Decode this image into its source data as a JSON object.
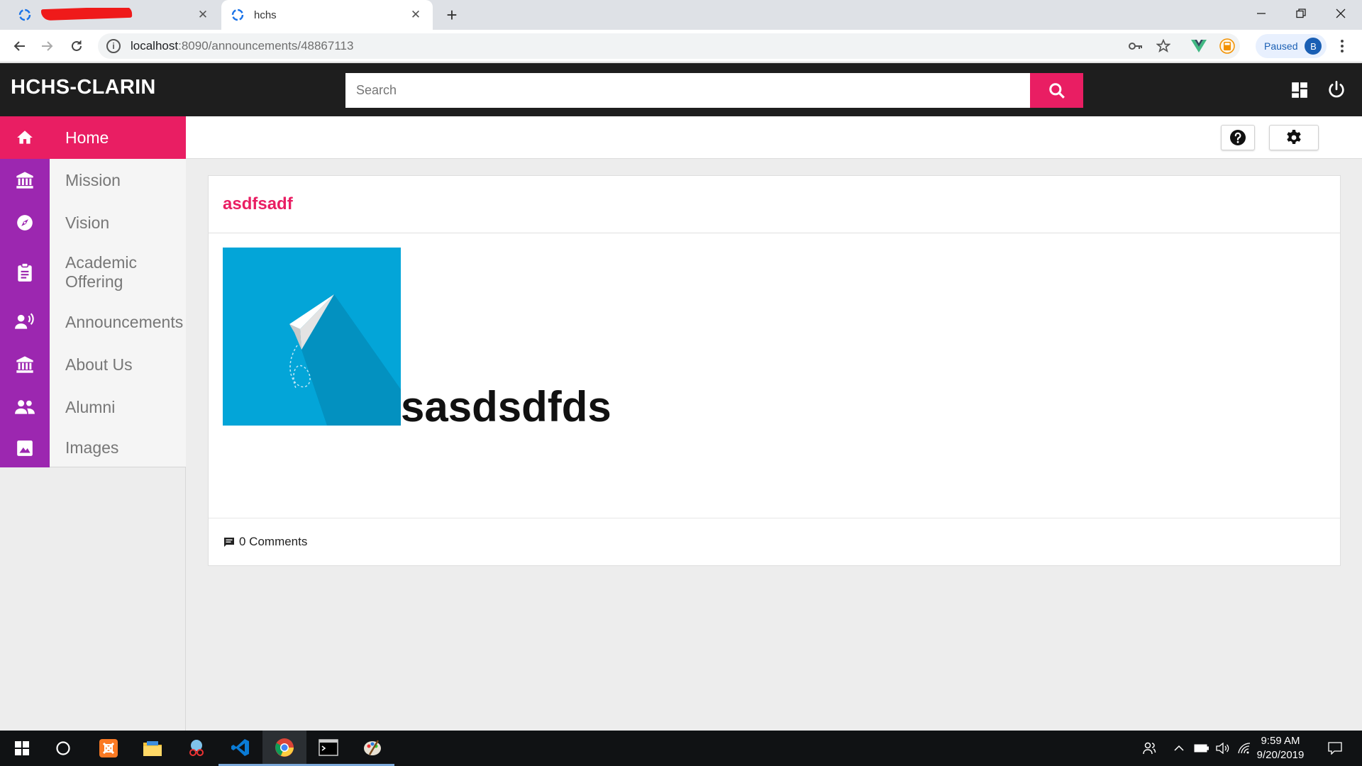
{
  "browser": {
    "tabs": [
      {
        "title": "",
        "redacted": true
      },
      {
        "title": "hchs",
        "active": true
      }
    ],
    "address": {
      "host": "localhost",
      "path": ":8090/announcements/48867113"
    },
    "profile": {
      "status": "Paused",
      "initial": "B"
    }
  },
  "app": {
    "brand": "HCHS-CLARIN",
    "search_placeholder": "Search",
    "accent_color": "#e91e63",
    "sidebar_color": "#9c27b0"
  },
  "sidebar": {
    "items": [
      {
        "label": "Home",
        "icon": "home-icon",
        "active": true
      },
      {
        "label": "Mission",
        "icon": "bank-icon"
      },
      {
        "label": "Vision",
        "icon": "compass-icon"
      },
      {
        "label": "Academic Offering",
        "icon": "clipboard-icon"
      },
      {
        "label": "Announcements",
        "icon": "speaker-icon"
      },
      {
        "label": "About Us",
        "icon": "bank-icon"
      },
      {
        "label": "Alumni",
        "icon": "people-icon"
      },
      {
        "label": "Images",
        "icon": "image-icon"
      }
    ]
  },
  "announcement": {
    "title": "asdfsadf",
    "body": "sasdsdfds",
    "image_icon": "paper-plane-icon",
    "comments_label": "0 Comments"
  },
  "taskbar": {
    "time": "9:59 AM",
    "date": "9/20/2019"
  }
}
